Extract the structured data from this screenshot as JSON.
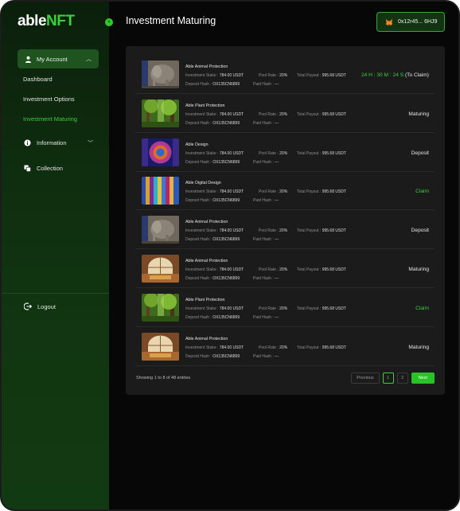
{
  "app": {
    "logo_prefix": "able",
    "logo_suffix": "NFT"
  },
  "sidebar": {
    "account": "My Account",
    "items": [
      "Dashboard",
      "Investment Options",
      "Investment Maturing"
    ],
    "information": "Information",
    "collection": "Collection",
    "logout": "Logout"
  },
  "header": {
    "title": "Investment Maturing",
    "wallet": "0x12r45... 6HJ9"
  },
  "labels": {
    "stake": "Investment Stake :",
    "pool": "Pool Rate :",
    "payout": "Total Payout :",
    "deposit_hash": "Deposit Hash :",
    "paid_hash": "Paid Hash :"
  },
  "rows": [
    {
      "name": "Able Animal Protection",
      "stake": "784.00 USDT",
      "pool": "20%",
      "payout": "995.68 USDT",
      "deposit_hash": "OX135CN6899",
      "paid_hash": "---",
      "status": "",
      "timer": "24 H : 30 M : 24 S",
      "timer_suffix": " (To Claim)",
      "thumb": "elephant"
    },
    {
      "name": "Able Plant Protection",
      "stake": "784.00 USDT",
      "pool": "20%",
      "payout": "995.68 USDT",
      "deposit_hash": "OX135CN6899",
      "paid_hash": "---",
      "status": "Maturing",
      "thumb": "forest"
    },
    {
      "name": "Able Design",
      "stake": "784.00 USDT",
      "pool": "20%",
      "payout": "995.68 USDT",
      "deposit_hash": "OX135CN6899",
      "paid_hash": "---",
      "status": "Deposit",
      "thumb": "design"
    },
    {
      "name": "Able Digital Design",
      "stake": "784.00 USDT",
      "pool": "20%",
      "payout": "995.68 USDT",
      "deposit_hash": "OX135CN6899",
      "paid_hash": "---",
      "status": "Claim",
      "thumb": "stripes"
    },
    {
      "name": "Able Animal Protection",
      "stake": "784.00 USDT",
      "pool": "20%",
      "payout": "995.68 USDT",
      "deposit_hash": "OX135CN6899",
      "paid_hash": "---",
      "status": "Deposit",
      "thumb": "elephant"
    },
    {
      "name": "Able Animal Protection",
      "stake": "784.00 USDT",
      "pool": "20%",
      "payout": "995.68 USDT",
      "deposit_hash": "OX135CN6899",
      "paid_hash": "---",
      "status": "Maturing",
      "thumb": "room"
    },
    {
      "name": "Able Plant Protection",
      "stake": "784.00 USDT",
      "pool": "20%",
      "payout": "995.68 USDT",
      "deposit_hash": "OX135CN6899",
      "paid_hash": "---",
      "status": "Claim",
      "thumb": "forest"
    },
    {
      "name": "Able Animal Protection",
      "stake": "784.00 USDT",
      "pool": "20%",
      "payout": "995.68 USDT",
      "deposit_hash": "OX135CN6899",
      "paid_hash": "---",
      "status": "Maturing",
      "thumb": "room"
    }
  ],
  "footer": {
    "entries": "Showing 1 to 8 of 48 entries",
    "previous": "Previous",
    "pages": [
      "1",
      "2"
    ],
    "next": "Next"
  },
  "colors": {
    "accent": "#3bd13b",
    "panel": "#1b1b1b",
    "sidebar": "#0f2e0f"
  }
}
